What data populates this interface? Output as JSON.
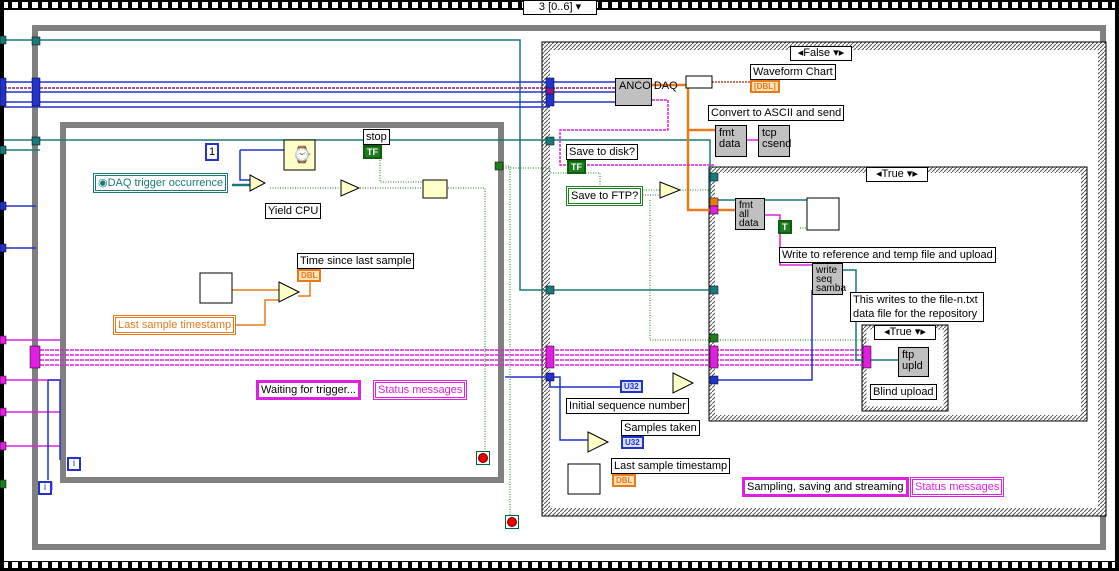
{
  "sequence": {
    "selector": "3 [0..6]"
  },
  "outer_case": {
    "selector": "False"
  },
  "inner_case": {
    "selector": "True"
  },
  "ftp_case": {
    "selector": "True"
  },
  "nodes": {
    "anco_daq": "ANCO DAQ",
    "fmt_data": "fmt data",
    "tcp_csend": "tcp csend",
    "fmt_all_data": "fmt all data",
    "write_seq_samba": "write seq samba",
    "ftp_upld": "ftp upld"
  },
  "labels": {
    "waveform_chart": "Waveform Chart",
    "convert_ascii": "Convert to ASCII and send",
    "save_to_disk": "Save to disk?",
    "save_to_ftp": "Save to FTP?",
    "write_reference": "Write to reference and temp file and upload",
    "file_n_comment": "This writes to the file-n.txt data file for the repository",
    "blind_upload": "Blind upload",
    "initial_sequence": "Initial sequence number",
    "samples_taken": "Samples taken",
    "last_sample_ts_right": "Last sample timestamp",
    "sampling_msg": "Sampling, saving and streaming",
    "status_messages_right": "Status messages",
    "stop": "stop",
    "daq_trigger": "DAQ trigger occurrence",
    "yield_cpu": "Yield CPU",
    "time_since_last": "Time since last sample",
    "last_sample_ts_left": "Last sample timestamp",
    "waiting_msg": "Waiting for trigger...",
    "status_messages_left": "Status messages"
  },
  "terminals": {
    "bool": "TF",
    "dbl": "DBL",
    "u32": "U32",
    "const_one": "1",
    "true_const": "T",
    "iteration": "i",
    "chart_term": "[DBL]"
  },
  "colors": {
    "structure": "#808080",
    "wire_blue": "#2233cc",
    "wire_orange": "#e87a1a",
    "wire_pink": "#e020e0",
    "wire_teal": "#1a7a7a",
    "wire_green": "#1e7d1e"
  }
}
